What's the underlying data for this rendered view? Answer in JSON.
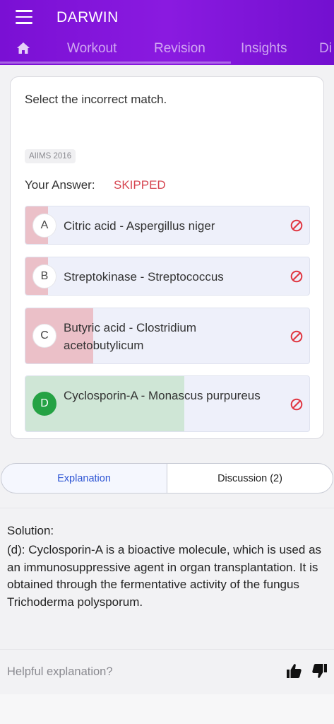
{
  "app": {
    "title": "DARWIN"
  },
  "tabs": [
    {
      "label": "",
      "icon": "home-icon"
    },
    {
      "label": "Workout"
    },
    {
      "label": "Revision"
    },
    {
      "label": "Insights"
    },
    {
      "label": "Di"
    }
  ],
  "question": {
    "text": "Select the incorrect match.",
    "tag": "AIIMS 2016",
    "answer_label": "Your Answer:",
    "answer_value": "SKIPPED"
  },
  "options": [
    {
      "letter": "A",
      "text": "Citric acid - Aspergillus niger",
      "percent": 8,
      "correct": false
    },
    {
      "letter": "B",
      "text": "Streptokinase - Streptococcus",
      "percent": 8,
      "correct": false
    },
    {
      "letter": "C",
      "text": "Butyric acid - Clostridium acetobutylicum",
      "percent": 24,
      "correct": false
    },
    {
      "letter": "D",
      "text": "Cyclosporin-A - Monascus purpureus",
      "percent": 56,
      "correct": true
    }
  ],
  "explanation_tabs": {
    "active": "Explanation",
    "other": "Discussion (2)"
  },
  "solution": {
    "title": "Solution:",
    "text": "(d): Cyclosporin-A is a bioactive molecule, which is used as an immunosuppressive agent in organ transplantation. It is obtained through the fermentative activity of the fungus Trichoderma polysporum."
  },
  "feedback": {
    "label": "Helpful explanation?"
  },
  "colors": {
    "header": "#7a10d4",
    "skipped": "#d64550",
    "wrong_fill": "#ebc0c8",
    "correct_fill": "#cfe6d6",
    "correct_badge": "#25a244",
    "link": "#2e55d4"
  }
}
